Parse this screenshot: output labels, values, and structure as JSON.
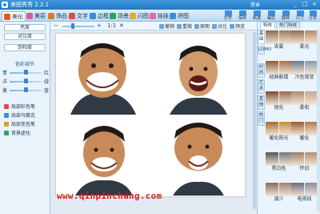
{
  "app": {
    "title": "美图秀秀 2.2.1",
    "login": "登录"
  },
  "window_controls": [
    "_",
    "□",
    "×"
  ],
  "tabs": [
    {
      "label": "美化",
      "active": true,
      "icon": "magic-wand-icon",
      "color": "#e05a28"
    },
    {
      "label": "美容",
      "active": false,
      "icon": "face-icon",
      "color": "#e6569b"
    },
    {
      "label": "饰品",
      "active": false,
      "icon": "bow-icon",
      "color": "#e07a26"
    },
    {
      "label": "文字",
      "active": false,
      "icon": "text-icon",
      "color": "#e04a4a"
    },
    {
      "label": "边框",
      "active": false,
      "icon": "frame-icon",
      "color": "#3d8bd6"
    },
    {
      "label": "场景",
      "active": false,
      "icon": "scene-icon",
      "color": "#2aa65a"
    },
    {
      "label": "闪图",
      "active": false,
      "icon": "flash-icon",
      "color": "#e0b020"
    },
    {
      "label": "娃娃",
      "active": false,
      "icon": "doll-icon",
      "color": "#e06aa0"
    },
    {
      "label": "拼图",
      "active": false,
      "icon": "puzzle-icon",
      "color": "#3d8bd6"
    }
  ],
  "top_tools": [
    "打开",
    "保存",
    "新建",
    "裁剪",
    "旋转",
    "尺寸",
    "分享"
  ],
  "left_panel": {
    "adjust_label": "亮度",
    "buttons": [
      "对比度",
      "饱和度"
    ],
    "color_section": "色彩调节",
    "color_sliders": [
      {
        "left": "青",
        "right": "红",
        "value": 0.5
      },
      {
        "left": "洋",
        "right": "绿",
        "value": 0.5
      },
      {
        "left": "黄",
        "right": "蓝",
        "value": 0.5
      }
    ],
    "tools": [
      {
        "label": "局部彩色笔",
        "icon": "brush-icon",
        "color": "#e04a4a"
      },
      {
        "label": "局部马赛克",
        "icon": "mosaic-icon",
        "color": "#3d8bd6"
      },
      {
        "label": "局部变色笔",
        "icon": "color-pen-icon",
        "color": "#e0a020"
      },
      {
        "label": "背景虚化",
        "icon": "blur-icon",
        "color": "#2aa65a"
      }
    ]
  },
  "zoom": {
    "minus": "−",
    "plus": "+",
    "value": "1:1",
    "fit": "✕"
  },
  "actions": [
    "撤销",
    "重做",
    "原图",
    "对比",
    "预览"
  ],
  "right_panel": {
    "tabs": [
      "特效",
      "热门特效"
    ],
    "vtabs": [
      "基础",
      "LOMO",
      "时尚",
      "艺术",
      "其他",
      "热门"
    ],
    "active_vtab": 0,
    "effects": [
      {
        "name": "去雾",
        "colors": [
          "#8a6a4a",
          "#9a7a5a"
        ]
      },
      {
        "name": "柔光",
        "colors": [
          "#9a6a4a",
          "#b88a6a"
        ]
      },
      {
        "name": "经典影楼",
        "colors": [
          "#8a5a3a",
          "#a86e4a"
        ]
      },
      {
        "name": "冷色渐变",
        "colors": [
          "#6a7a8a",
          "#8a9aaa"
        ]
      },
      {
        "name": "锐化",
        "colors": [
          "#7a4a2a",
          "#9a6a4a"
        ]
      },
      {
        "name": "柔和",
        "colors": [
          "#b08a6a",
          "#c8a48a"
        ]
      },
      {
        "name": "暖化阳光",
        "colors": [
          "#a86a2a",
          "#c88a3a"
        ]
      },
      {
        "name": "暖化",
        "colors": [
          "#9a5a2a",
          "#b87a4a"
        ]
      },
      {
        "name": "黑白色",
        "colors": [
          "#555555",
          "#777777"
        ]
      },
      {
        "name": "怀旧",
        "colors": [
          "#9a8060",
          "#b09070"
        ]
      },
      {
        "name": "减少",
        "colors": [
          "#8a6a5a",
          "#a08070"
        ]
      },
      {
        "name": "电视线",
        "colors": [
          "#6a6a7a",
          "#8a8a9a"
        ]
      }
    ]
  },
  "watermark": "www.qinpinchang.com",
  "accent": "#2479c4"
}
